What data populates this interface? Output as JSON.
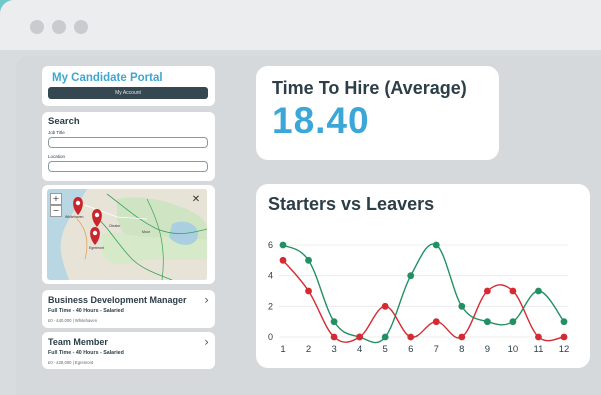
{
  "portal": {
    "title": "My Candidate Portal",
    "account_button": "My Account"
  },
  "search": {
    "title": "Search",
    "job_title_label": "Job Title",
    "location_label": "Location",
    "job_title_value": "",
    "location_value": ""
  },
  "map": {
    "zoom_in": "+",
    "zoom_out": "−",
    "close": "✕",
    "places": [
      "Whitehaven",
      "Egremont",
      "Cleator",
      "Moor"
    ]
  },
  "jobs": [
    {
      "title": "Business Development Manager",
      "type": "Full Time - 40 Hours - Salaried",
      "meta": "£0 - £40,000 | Whitehaven"
    },
    {
      "title": "Team Member",
      "type": "Full Time - 40 Hours - Salaried",
      "meta": "£0 - £28,000 | Egremont"
    }
  ],
  "time_to_hire": {
    "label": "Time To Hire (Average)",
    "value": "18.40"
  },
  "colors": {
    "accent": "#3aa7d8",
    "starters": "#239063",
    "leavers": "#d42b32",
    "dark": "#2c3e48"
  },
  "chart_data": {
    "type": "line",
    "title": "Starters vs Leavers",
    "categories": [
      "1",
      "2",
      "3",
      "4",
      "5",
      "6",
      "7",
      "8",
      "9",
      "10",
      "11",
      "12"
    ],
    "yticks": [
      "0",
      "2",
      "4",
      "6"
    ],
    "ylim": [
      0,
      6
    ],
    "grid": true,
    "series": [
      {
        "color": "#239063",
        "values": [
          6,
          5,
          1,
          0,
          0,
          4,
          6,
          2,
          1,
          1,
          3,
          1
        ]
      },
      {
        "color": "#d42b32",
        "values": [
          5,
          3,
          0,
          0,
          2,
          0,
          1,
          0,
          3,
          3,
          0,
          0
        ]
      }
    ]
  }
}
